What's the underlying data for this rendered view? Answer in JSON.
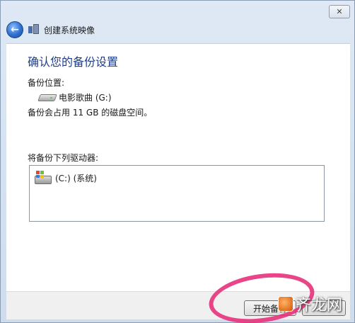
{
  "window": {
    "title": "创建系统映像",
    "close_glyph": "✕"
  },
  "nav": {
    "back_glyph": "←"
  },
  "page": {
    "heading": "确认您的备份设置",
    "backup_location_label": "备份位置:",
    "backup_drive": "电影歌曲 (G:)",
    "space_note": "备份会占用 11 GB 的磁盘空间。",
    "drives_label": "将备份下列驱动器:",
    "drives": [
      {
        "name": "(C:) (系统)",
        "icon": "windows-system-drive-icon"
      }
    ]
  },
  "footer": {
    "start_label": "开始备份",
    "cancel_label": ""
  },
  "watermark": {
    "text": "齐龙网"
  },
  "colors": {
    "heading": "#1e3d8a",
    "annotation": "#e8317b"
  }
}
